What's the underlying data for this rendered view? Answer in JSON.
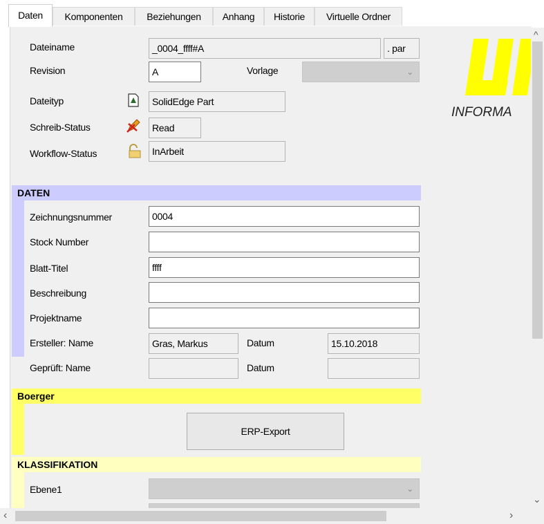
{
  "tabs": [
    "Daten",
    "Komponenten",
    "Beziehungen",
    "Anhang",
    "Historie",
    "Virtuelle Ordner"
  ],
  "header_fields": {
    "dateiname_label": "Dateiname",
    "dateiname_value": "_0004_ffff#A",
    "extension": ". par",
    "revision_label": "Revision",
    "revision_value": "A",
    "vorlage_label": "Vorlage",
    "vorlage_value": "",
    "dateityp_label": "Dateityp",
    "dateityp_value": "SolidEdge Part",
    "schreib_label": "Schreib-Status",
    "schreib_value": "Read",
    "workflow_label": "Workflow-Status",
    "workflow_value": "InArbeit"
  },
  "logo": {
    "subtitle": "INFORMA"
  },
  "sections": {
    "daten": "DATEN",
    "boerger": "Boerger",
    "klassifikation": "KLASSIFIKATION"
  },
  "daten_fields": {
    "zeichnungsnummer_label": "Zeichnungsnummer",
    "zeichnungsnummer_value": "0004",
    "stock_label": "Stock Number",
    "stock_value": "",
    "blatt_label": "Blatt-Titel",
    "blatt_value": "ffff",
    "beschreibung_label": "Beschreibung",
    "beschreibung_value": "",
    "projekt_label": "Projektname",
    "projekt_value": "",
    "ersteller_label": "Ersteller: Name",
    "ersteller_value": "Gras, Markus",
    "datum1_label": "Datum",
    "datum1_value": "15.10.2018",
    "geprueft_label": "Geprüft: Name",
    "geprueft_value": "",
    "datum2_label": "Datum",
    "datum2_value": ""
  },
  "boerger": {
    "erp_button": "ERP-Export"
  },
  "klassifikation": {
    "ebene1_label": "Ebene1",
    "ebene1_value": ""
  },
  "colors": {
    "daten_header": "#ccccff",
    "boerger_header": "#ffff66",
    "klass_header": "#ffffc0",
    "logo_yellow": "#ffff00"
  },
  "icons": {
    "dateityp": "solidedge-part-icon",
    "schreib": "pencil-write-icon",
    "workflow": "lock-icon"
  }
}
